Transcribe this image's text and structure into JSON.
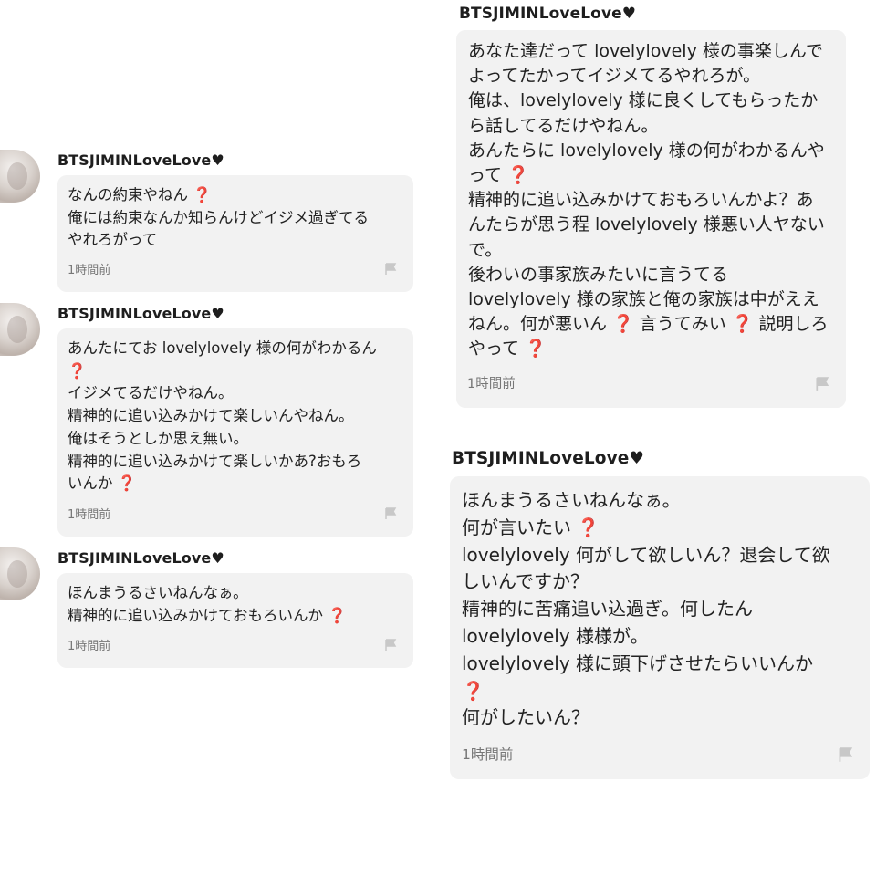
{
  "messages_left": [
    {
      "username": "BTSJIMINLoveLove",
      "lines": [
        "なんの約束やねん ❓",
        "俺には約束なんか知らんけどイジメ過ぎてる",
        "やれろがって"
      ],
      "time": "1時間前"
    },
    {
      "username": "BTSJIMINLoveLove",
      "lines": [
        "あんたにてお lovelylovely 様の何がわかるん",
        "❓",
        "イジメてるだけやねん。",
        "精神的に追い込みかけて楽しいんやねん。",
        "俺はそうとしか思え無い。",
        "精神的に追い込みかけて楽しいかあ?おもろ",
        "いんか ❓"
      ],
      "time": "1時間前"
    },
    {
      "username": "BTSJIMINLoveLove",
      "lines": [
        "ほんまうるさいねんなぁ。",
        "精神的に追い込みかけておもろいんか ❓"
      ],
      "time": "1時間前"
    }
  ],
  "messages_right": [
    {
      "username": "BTSJIMINLoveLove",
      "lines": [
        "あなた達だって lovelylovely 様の事楽しんで",
        "よってたかってイジメてるやれろが。",
        "俺は、lovelylovely 様に良くしてもらったか",
        "ら話してるだけやねん。",
        "あんたらに lovelylovely 様の何がわかるんや",
        "って ❓",
        "精神的に追い込みかけておもろいんかよ？あ",
        "んたらが思う程 lovelylovely 様悪い人ヤない",
        "で。",
        "後わいの事家族みたいに言うてる",
        "lovelylovely 様の家族と俺の家族は中がええ",
        "ねん。何が悪いん ❓ 言うてみい ❓ 説明しろ",
        "やって ❓"
      ],
      "time": "1時間前"
    },
    {
      "username": "BTSJIMINLoveLove",
      "lines": [
        "ほんまうるさいねんなぁ。",
        "何が言いたい ❓",
        "lovelylovely 何がして欲しいん？退会して欲",
        "しいんですか？",
        "精神的に苦痛追い込過ぎ。何したん",
        "lovelylovely 様様が。",
        "lovelylovely 様に頭下げさせたらいいんか",
        "❓",
        "何がしたいん？"
      ],
      "time": "1時間前"
    }
  ],
  "heart_symbol": "♥",
  "colors": {
    "bubble_bg": "#f2f2f2",
    "question_mark": "#d0243a",
    "time_text": "#777777",
    "flag_icon": "#c8c8c8"
  },
  "icons": [
    "avatar",
    "heart-icon",
    "report-flag-icon",
    "question-mark-icon"
  ]
}
